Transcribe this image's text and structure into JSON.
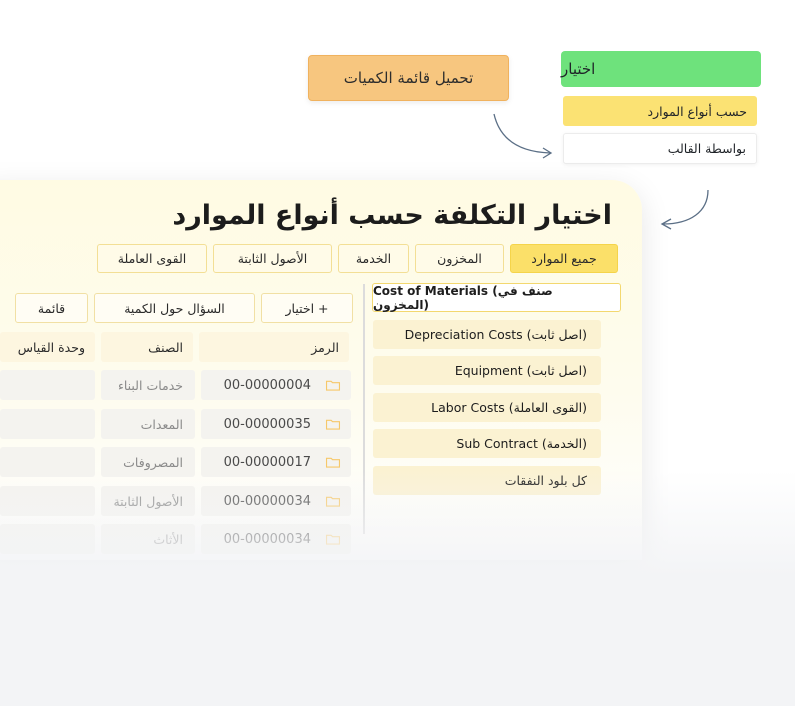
{
  "flow": {
    "load_quantities": "تحميل قائمة الكميات",
    "choose": "اختيار",
    "by_resource_type": "حسب أنواع الموارد",
    "by_template": "بواسطة القالب"
  },
  "panel": {
    "title": "اختيار التكلفة حسب أنواع الموارد",
    "tabs": [
      {
        "label": "جميع الموارد",
        "active": true
      },
      {
        "label": "المخزون",
        "active": false
      },
      {
        "label": "الخدمة",
        "active": false
      },
      {
        "label": "الأصول الثابتة",
        "active": false
      },
      {
        "label": "القوى العاملة",
        "active": false
      }
    ],
    "actions": {
      "choose": "+ اختيار",
      "ask_quantity": "السؤال حول الكمية",
      "list": "قائمة"
    },
    "columns": {
      "code": "الرمز",
      "category": "الصنف",
      "unit": "وحدة القياس"
    },
    "rows": [
      {
        "code": "00-00000004",
        "category": "خدمات البناء"
      },
      {
        "code": "00-00000035",
        "category": "المعدات"
      },
      {
        "code": "00-00000017",
        "category": "المصروفات"
      },
      {
        "code": "00-00000034",
        "category": "الأصول الثابتة"
      },
      {
        "code": "00-00000034",
        "category": "الأثاث"
      }
    ],
    "resource_types": [
      "Cost of Materials (صنف في المخزون)",
      "Depreciation Costs (اصل ثابت)",
      "Equipment (اصل ثابت)",
      "Labor Costs (القوى العاملة)",
      "Sub Contract (الخدمة)",
      "كل بلود النفقات"
    ]
  },
  "colors": {
    "accent_yellow": "#fbe069",
    "green": "#6ee27c",
    "orange": "#f7c67f",
    "folder": "#f6c86a"
  },
  "icons": [
    "folder-icon",
    "arrow-curve-icon"
  ]
}
